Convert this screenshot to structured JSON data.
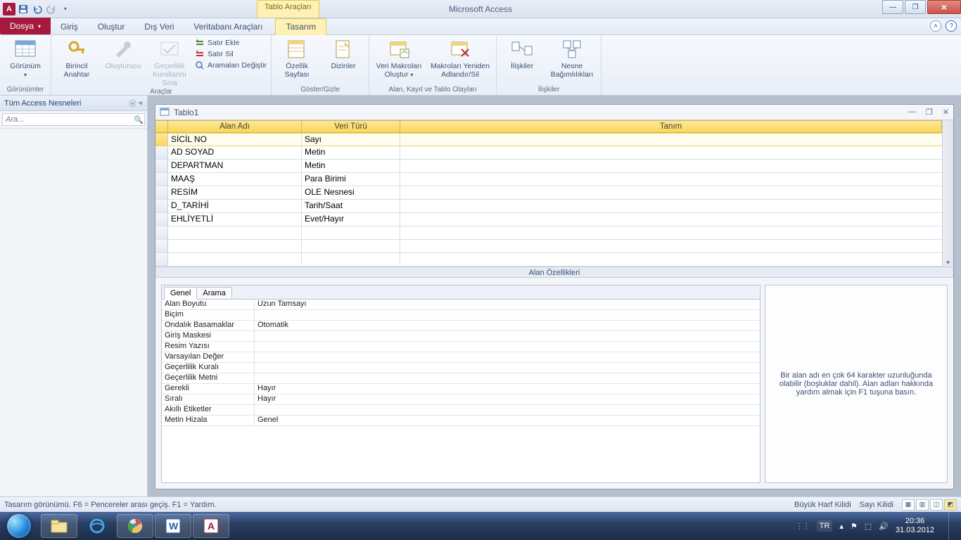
{
  "title": "Microsoft Access",
  "contextual_tab_group": "Tablo Araçları",
  "qat": {
    "app": "A"
  },
  "menutabs": {
    "file": "Dosya",
    "items": [
      "Giriş",
      "Oluştur",
      "Dış Veri",
      "Veritabanı Araçları",
      "Tasarım"
    ]
  },
  "ribbon": {
    "views": {
      "view_btn": "Görünüm",
      "group": "Görünümler"
    },
    "tools": {
      "pk": "Birincil\nAnahtar",
      "builder": "Oluşturucu",
      "validate": "Geçerlilik\nKurallarını Sına",
      "insert_row": "Satır Ekle",
      "delete_row": "Satır Sil",
      "modify_lookups": "Aramaları Değiştir",
      "group": "Araçlar"
    },
    "showhide": {
      "prop_sheet": "Özellik\nSayfası",
      "indexes": "Dizinler",
      "group": "Göster/Gizle"
    },
    "events": {
      "datamacros": "Veri Makroları\nOluştur",
      "rename": "Makroları Yeniden\nAdlandır/Sil",
      "group": "Alan, Kayıt ve Tablo Olayları"
    },
    "relationships": {
      "rel": "İlişkiler",
      "dep": "Nesne\nBağımlılıkları",
      "group": "İlişkiler"
    }
  },
  "nav": {
    "header": "Tüm Access Nesneleri",
    "search_placeholder": "Ara..."
  },
  "table_window": {
    "title": "Tablo1"
  },
  "grid": {
    "headers": {
      "name": "Alan Adı",
      "type": "Veri Türü",
      "desc": "Tanım"
    },
    "rows": [
      {
        "name": "SİCİL NO",
        "type": "Sayı",
        "selected": true
      },
      {
        "name": "AD SOYAD",
        "type": "Metin"
      },
      {
        "name": "DEPARTMAN",
        "type": "Metin"
      },
      {
        "name": "MAAŞ",
        "type": "Para Birimi"
      },
      {
        "name": "RESİM",
        "type": "OLE Nesnesi"
      },
      {
        "name": "D_TARİHİ",
        "type": "Tarih/Saat"
      },
      {
        "name": "EHLİYETLİ",
        "type": "Evet/Hayır"
      }
    ]
  },
  "splitter": "Alan Özellikleri",
  "prop_tabs": {
    "general": "Genel",
    "lookup": "Arama"
  },
  "properties": [
    {
      "label": "Alan Boyutu",
      "value": "Uzun Tamsayı"
    },
    {
      "label": "Biçim",
      "value": ""
    },
    {
      "label": "Ondalık Basamaklar",
      "value": "Otomatik"
    },
    {
      "label": "Giriş Maskesi",
      "value": ""
    },
    {
      "label": "Resim Yazısı",
      "value": ""
    },
    {
      "label": "Varsayılan Değer",
      "value": ""
    },
    {
      "label": "Geçerlilik Kuralı",
      "value": ""
    },
    {
      "label": "Geçerlilik Metni",
      "value": ""
    },
    {
      "label": "Gerekli",
      "value": "Hayır"
    },
    {
      "label": "Sıralı",
      "value": "Hayır"
    },
    {
      "label": "Akıllı Etiketler",
      "value": ""
    },
    {
      "label": "Metin Hizala",
      "value": "Genel"
    }
  ],
  "help_text": "Bir alan adı en çok 64 karakter uzunluğunda olabilir (boşluklar dahil). Alan adları hakkında yardım almak için F1 tuşuna basın.",
  "status": {
    "left": "Tasarım görünümü.  F6 = Pencereler arası geçiş.  F1 = Yardım.",
    "caps": "Büyük Harf Kilidi",
    "num": "Sayı Kilidi"
  },
  "taskbar": {
    "lang": "TR",
    "time": "20:36",
    "date": "31.03.2012"
  }
}
